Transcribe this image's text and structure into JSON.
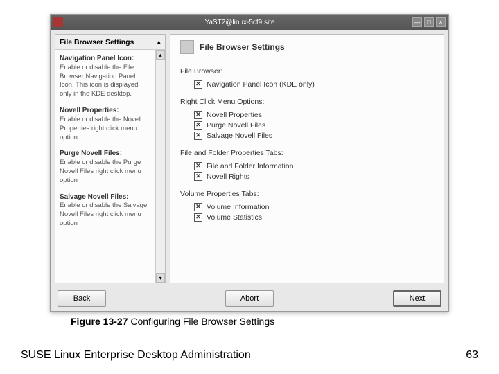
{
  "window": {
    "title": "YaST2@linux-5cf9.site"
  },
  "sidebar": {
    "header": "File Browser Settings",
    "items": [
      {
        "title": "Navigation Panel Icon:",
        "desc": "Enable or disable the File Browser Navigation Panel Icon. This icon is displayed only in the KDE desktop."
      },
      {
        "title": "Novell Properties:",
        "desc": "Enable or disable the Novell Properties right click menu option"
      },
      {
        "title": "Purge Novell Files:",
        "desc": "Enable or disable the Purge Novell Files right click menu option"
      },
      {
        "title": "Salvage Novell Files:",
        "desc": "Enable or disable the Salvage Novell Files right click menu option"
      }
    ]
  },
  "main": {
    "title": "File Browser Settings",
    "groups": [
      {
        "title": "File Browser:",
        "options": [
          {
            "label": "Navigation Panel Icon (KDE only)",
            "checked": true
          }
        ]
      },
      {
        "title": "Right Click Menu Options:",
        "options": [
          {
            "label": "Novell Properties",
            "checked": true
          },
          {
            "label": "Purge Novell Files",
            "checked": true
          },
          {
            "label": "Salvage Novell Files",
            "checked": true
          }
        ]
      },
      {
        "title": "File and Folder Properties Tabs:",
        "options": [
          {
            "label": "File and Folder Information",
            "checked": true
          },
          {
            "label": "Novell Rights",
            "checked": true
          }
        ]
      },
      {
        "title": "Volume Properties Tabs:",
        "options": [
          {
            "label": "Volume Information",
            "checked": true
          },
          {
            "label": "Volume Statistics",
            "checked": true
          }
        ]
      }
    ]
  },
  "buttons": {
    "back": "Back",
    "abort": "Abort",
    "next": "Next"
  },
  "caption": {
    "fig": "Figure 13-27",
    "text": " Configuring File Browser Settings"
  },
  "footer": {
    "book": "SUSE Linux Enterprise Desktop Administration",
    "page": "63"
  }
}
